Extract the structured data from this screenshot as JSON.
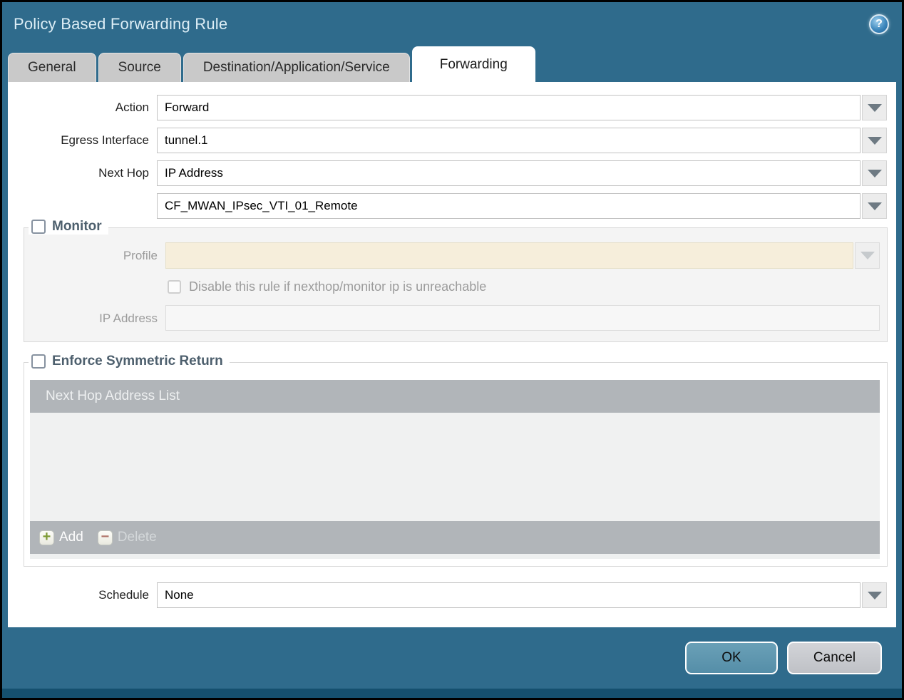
{
  "dialog": {
    "title": "Policy Based Forwarding Rule"
  },
  "help": {
    "icon": "?"
  },
  "tabs": [
    {
      "label": "General",
      "active": false
    },
    {
      "label": "Source",
      "active": false
    },
    {
      "label": "Destination/Application/Service",
      "active": false
    },
    {
      "label": "Forwarding",
      "active": true
    }
  ],
  "form": {
    "action": {
      "label": "Action",
      "value": "Forward"
    },
    "egress_interface": {
      "label": "Egress Interface",
      "value": "tunnel.1"
    },
    "next_hop": {
      "label": "Next Hop",
      "value": "IP Address"
    },
    "next_hop_address": {
      "value": "CF_MWAN_IPsec_VTI_01_Remote"
    },
    "monitor": {
      "label": "Monitor",
      "checked": false,
      "profile": {
        "label": "Profile",
        "value": ""
      },
      "disable_rule": {
        "label": "Disable this rule if nexthop/monitor ip is unreachable",
        "checked": false
      },
      "ip_address": {
        "label": "IP Address",
        "value": ""
      }
    },
    "enforce_symmetric_return": {
      "label": "Enforce Symmetric Return",
      "checked": false,
      "list": {
        "header": "Next Hop Address List",
        "rows": []
      },
      "add_label": "Add",
      "delete_label": "Delete"
    },
    "schedule": {
      "label": "Schedule",
      "value": "None"
    }
  },
  "footer": {
    "ok_label": "OK",
    "cancel_label": "Cancel"
  },
  "colors": {
    "header_teal": "#2f6b8c",
    "bottom_strip": "#15506f",
    "ok_button": "#5e95ad",
    "table_gray": "#b1b5b9",
    "profile_disabled_bg": "#f6eedb",
    "add_green": "#7d9a34",
    "delete_red": "#b0756a"
  }
}
